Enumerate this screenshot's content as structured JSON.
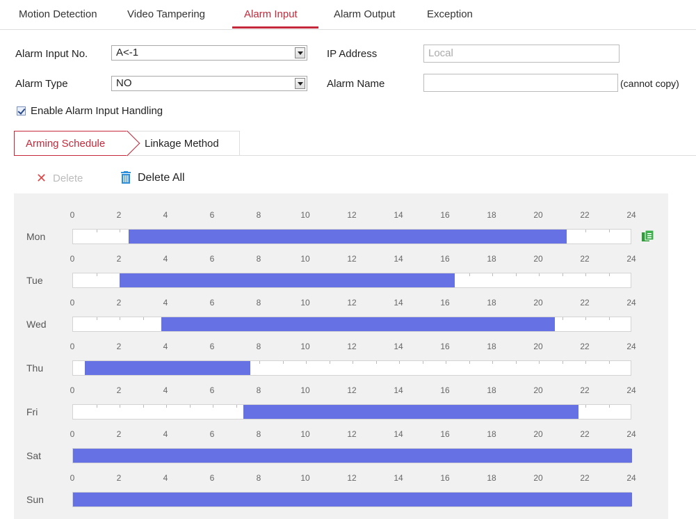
{
  "tabs": [
    {
      "label": "Motion Detection",
      "active": false
    },
    {
      "label": "Video Tampering",
      "active": false
    },
    {
      "label": "Alarm Input",
      "active": true
    },
    {
      "label": "Alarm Output",
      "active": false
    },
    {
      "label": "Exception",
      "active": false
    }
  ],
  "form": {
    "alarm_input_no_label": "Alarm Input No.",
    "alarm_input_no_value": "A<-1",
    "ip_address_label": "IP Address",
    "ip_address_placeholder": "Local",
    "alarm_type_label": "Alarm Type",
    "alarm_type_value": "NO",
    "alarm_name_label": "Alarm Name",
    "alarm_name_value": "",
    "alarm_name_note": "(cannot copy)",
    "enable_label": "Enable Alarm Input Handling",
    "enable_checked": true
  },
  "subtabs": {
    "arming_schedule": "Arming Schedule",
    "linkage_method": "Linkage Method"
  },
  "toolbar": {
    "delete_label": "Delete",
    "delete_all_label": "Delete All"
  },
  "schedule": {
    "ticks": [
      "0",
      "2",
      "4",
      "6",
      "8",
      "10",
      "12",
      "14",
      "16",
      "18",
      "20",
      "22",
      "24"
    ],
    "days": [
      {
        "label": "Mon",
        "start": 2.4,
        "end": 21.2
      },
      {
        "label": "Tue",
        "start": 2.0,
        "end": 16.4
      },
      {
        "label": "Wed",
        "start": 3.8,
        "end": 20.7
      },
      {
        "label": "Thu",
        "start": 0.5,
        "end": 7.6
      },
      {
        "label": "Fri",
        "start": 7.3,
        "end": 21.7
      },
      {
        "label": "Sat",
        "start": 0,
        "end": 24
      },
      {
        "label": "Sun",
        "start": 0,
        "end": 24
      }
    ]
  },
  "colors": {
    "accent": "#c5283a",
    "schedule_bar": "#6672e4",
    "copy_icon": "#2f9c3a",
    "trash_icon": "#2f8fd8"
  }
}
